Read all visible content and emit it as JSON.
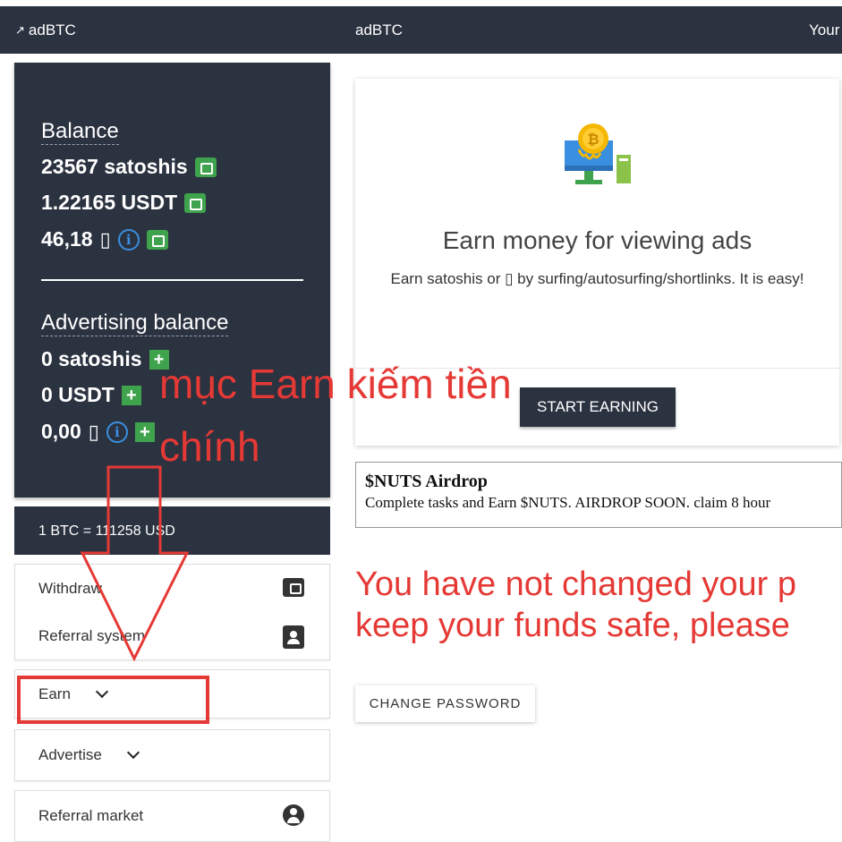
{
  "topbar": {
    "left_brand": "adBTC",
    "left_arrow": "↗",
    "center_brand": "adBTC",
    "right_item": "Your"
  },
  "balance": {
    "heading": "Balance",
    "satoshis": "23567 satoshis",
    "usdt": "1.22165 USDT",
    "other": "46,18",
    "other_glyph": "▯"
  },
  "advertising_balance": {
    "heading": "Advertising balance",
    "satoshis": "0 satoshis",
    "usdt": "0 USDT",
    "other": "0,00",
    "other_glyph": "▯"
  },
  "rate": "1 BTC = 111258 USD",
  "menu": {
    "withdraw": "Withdraw",
    "referral_system": "Referral system",
    "earn": "Earn",
    "advertise": "Advertise",
    "referral_market": "Referral market"
  },
  "earn_card": {
    "title": "Earn money for viewing ads",
    "description": "Earn satoshis or ▯ by surfing/autosurfing/shortlinks. It is easy!",
    "button": "START EARNING"
  },
  "airdrop": {
    "title": "$NUTS Airdrop",
    "description": "Complete tasks and Earn $NUTS. AIRDROP SOON. claim 8 hour"
  },
  "warning": {
    "line1": "You have not changed your p",
    "line2": "keep your funds safe, please"
  },
  "change_password_button": "CHANGE PASSWORD",
  "annotation": {
    "line1": "mục Earn kiếm tiền",
    "line2": "chính",
    "color": "#e53935"
  },
  "colors": {
    "dark": "#2b3240",
    "green": "#3fa34d",
    "info_blue": "#3b8fe0",
    "warning_red": "#e53935"
  }
}
